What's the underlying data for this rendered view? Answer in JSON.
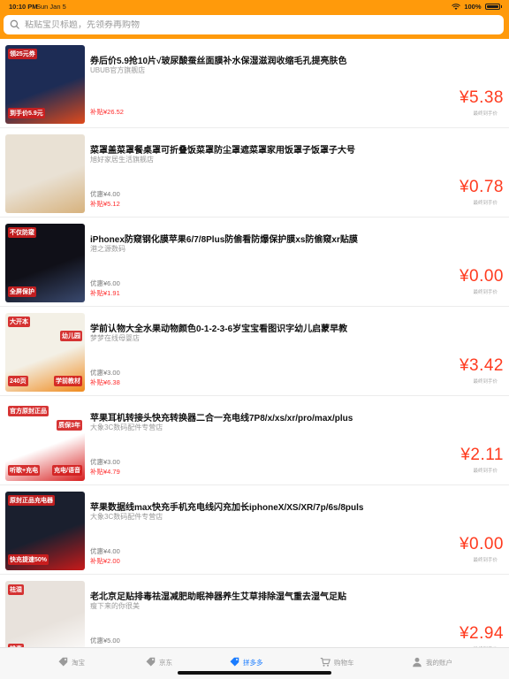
{
  "status_bar": {
    "time": "10:10 PM",
    "date": "Sun Jan 5",
    "battery": "100%"
  },
  "search": {
    "placeholder": "粘贴宝贝标题，先领券再购物"
  },
  "products": [
    {
      "title": "券后价5.9抢10片√玻尿酸蚕丝面膜补水保湿滋润收缩毛孔提亮肤色",
      "shop": "UBUB官方旗舰店",
      "coupon": "",
      "subsidy": "补贴¥26.52",
      "price": "¥5.38",
      "final_label": "最终到手价",
      "thumb": {
        "badge_texts": [
          "领25元券",
          "到手价5.9元"
        ],
        "colors": [
          "#1d2c55",
          "#e04a1c"
        ]
      }
    },
    {
      "title": "菜罩盖菜罩餐桌罩可折叠饭菜罩防尘罩遮菜罩家用饭罩子饭罩子大号",
      "shop": "旭好家居生活旗舰店",
      "coupon": "优惠¥4.00",
      "subsidy": "补贴¥5.12",
      "price": "¥0.78",
      "final_label": "最终到手价",
      "thumb": {
        "badge_texts": [],
        "colors": [
          "#e9e1d4",
          "#d7b27d"
        ]
      }
    },
    {
      "title": "iPhonex防窥钢化膜苹果6/7/8Plus防偷看防爆保护膜xs防偷窥xr贴膜",
      "shop": "港之源数码",
      "coupon": "优惠¥6.00",
      "subsidy": "补贴¥1.91",
      "price": "¥0.00",
      "final_label": "最终到手价",
      "thumb": {
        "badge_texts": [
          "不仅防窥",
          "全屏保护"
        ],
        "colors": [
          "#101018",
          "#3a4a70"
        ]
      }
    },
    {
      "title": "学前认物大全水果动物颜色0-1-2-3-6岁宝宝看图识字幼儿启蒙早教",
      "shop": "梦梦在线母婴店",
      "coupon": "优惠¥3.00",
      "subsidy": "补贴¥6.38",
      "price": "¥3.42",
      "final_label": "最终到手价",
      "thumb": {
        "badge_texts": [
          "大开本",
          "240页",
          "幼儿园",
          "学前教材"
        ],
        "colors": [
          "#f3f0e6",
          "#f08a1c"
        ]
      }
    },
    {
      "title": "苹果耳机转接头快充转换器二合一充电线7P8/x/xs/xr/pro/max/plus",
      "shop": "大象3C数码配件专营店",
      "coupon": "优惠¥3.00",
      "subsidy": "补贴¥4.79",
      "price": "¥2.11",
      "final_label": "最终到手价",
      "thumb": {
        "badge_texts": [
          "官方原封正品",
          "听歌+充电",
          "质保3年",
          "充电/语音"
        ],
        "colors": [
          "#ffffff",
          "#d81e1e"
        ]
      }
    },
    {
      "title": "苹果数据线max快充手机充电线闪充加长iphoneX/XS/XR/7p/6s/8puls",
      "shop": "大象3C数码配件专营店",
      "coupon": "优惠¥4.00",
      "subsidy": "补贴¥2.00",
      "price": "¥0.00",
      "final_label": "最终到手价",
      "thumb": {
        "badge_texts": [
          "原封正品充电器",
          "快充提速50%"
        ],
        "colors": [
          "#1a1f2e",
          "#c81a1a"
        ]
      }
    },
    {
      "title": "老北京足贴排毒祛湿减肥助眠神器养生艾草排除湿气重去湿气足贴",
      "shop": "瘦下来的你很美",
      "coupon": "优惠¥5.00",
      "subsidy": "",
      "price": "¥2.94",
      "final_label": "最终到手价",
      "thumb": {
        "badge_texts": [
          "祛湿",
          "排毒"
        ],
        "colors": [
          "#e8e2dc",
          "#ffffff"
        ]
      }
    }
  ],
  "tabbar": {
    "tabs": [
      {
        "label": "淘宝",
        "icon": "tag-icon"
      },
      {
        "label": "京东",
        "icon": "tag-icon"
      },
      {
        "label": "拼多多",
        "icon": "tag-icon",
        "active": true
      },
      {
        "label": "购物车",
        "icon": "cart-icon"
      },
      {
        "label": "我的账户",
        "icon": "person-icon"
      }
    ]
  },
  "colors": {
    "header": "#ff9a0b",
    "price": "#ff3b1f",
    "subsidy": "#ff2a2a",
    "active_tab": "#1a7cff"
  }
}
